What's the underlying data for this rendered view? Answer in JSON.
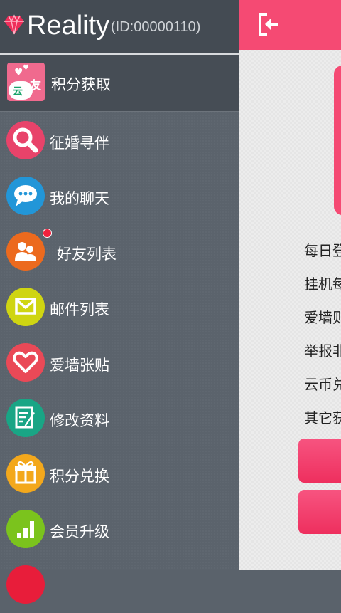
{
  "header": {
    "app_name": "Reality",
    "user_id": "(ID:00000110)"
  },
  "points_row": {
    "label": "积分获取",
    "logo_char_1": "云",
    "logo_char_2": "友"
  },
  "menu": [
    {
      "label": "征婚寻伴",
      "icon": "search-icon",
      "color": "#e8436a"
    },
    {
      "label": "我的聊天",
      "icon": "chat-icon",
      "color": "#2296d8"
    },
    {
      "label": "好友列表",
      "icon": "friends-icon",
      "color": "#ec6a1e",
      "has_badge": true
    },
    {
      "label": "邮件列表",
      "icon": "mail-icon",
      "color": "#cfd512"
    },
    {
      "label": "爱墙张贴",
      "icon": "heart-icon",
      "color": "#ea4957"
    },
    {
      "label": "修改资料",
      "icon": "edit-icon",
      "color": "#19a585"
    },
    {
      "label": "积分兑换",
      "icon": "gift-icon",
      "color": "#f3a81c"
    },
    {
      "label": "会员升级",
      "icon": "level-icon",
      "color": "#7bc31d"
    }
  ],
  "right_panel": {
    "lines": [
      "每日登",
      "挂机每",
      "爱墙则",
      "举报非",
      "云币兑",
      "其它获"
    ]
  },
  "colors": {
    "accent": "#f54a73",
    "drawer_bg": "#5b636c",
    "header_bg": "#444b53"
  }
}
